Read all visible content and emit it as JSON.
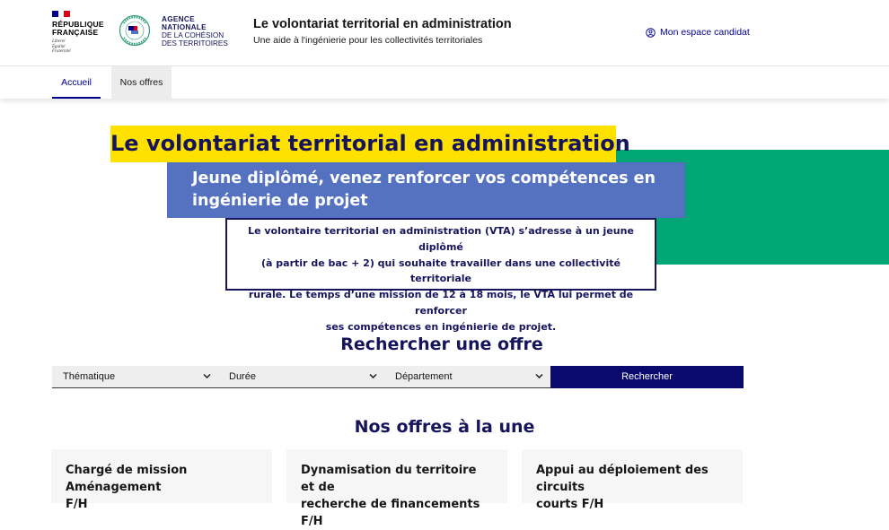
{
  "header": {
    "rf_name_line1": "RÉPUBLIQUE",
    "rf_name_line2": "FRANÇAISE",
    "rf_motto_line1": "Liberté",
    "rf_motto_line2": "Égalité",
    "rf_motto_line3": "Fraternité",
    "anct_line1": "AGENCE",
    "anct_line2": "NATIONALE",
    "anct_line3": "DE LA COHÉSION",
    "anct_line4": "DES TERRITOIRES",
    "anct_ring_text": "FRANCE RELANCE",
    "site_title": "Le volontariat territorial en administration",
    "site_tagline": "Une aide à l'ingénierie pour les collectivités territoriales",
    "account_label": "Mon espace candidat",
    "account_icon": "user-circle-icon"
  },
  "nav": {
    "home_label": "Accueil",
    "offers_label": "Nos offres"
  },
  "hero": {
    "title": "Le volontariat territorial en administration",
    "subtitle_line1": "Jeune diplômé, venez renforcer vos compétences en",
    "subtitle_line2": "ingénierie de projet",
    "desc_line1": "Le volontaire territorial en administration (VTA) s’adresse à un jeune diplômé",
    "desc_line2": "(à partir de bac + 2) qui souhaite travailler dans une collectivité territoriale",
    "desc_line3": "rurale. Le temps d’une mission de 12 à 18 mois, le VTA lui permet de renforcer",
    "desc_line4": "ses compétences en ingénierie de projet."
  },
  "search": {
    "title": "Rechercher une offre",
    "theme_value": "Thématique",
    "duration_value": "Durée",
    "department_value": "Département",
    "submit_label": "Rechercher"
  },
  "offers": {
    "title": "Nos offres à la une",
    "cards": [
      {
        "line1": "Chargé de mission Aménagement",
        "line2": "F/H"
      },
      {
        "line1": "Dynamisation du territoire et de",
        "line2": "recherche de financements F/H"
      },
      {
        "line1": "Appui au déploiement des circuits",
        "line2": "courts F/H"
      }
    ]
  },
  "colors": {
    "brand_blue": "#000091",
    "hero_yellow": "#ffe100",
    "hero_blue": "#5472c0",
    "hero_green": "#00a676",
    "navy_text": "#16155c"
  }
}
